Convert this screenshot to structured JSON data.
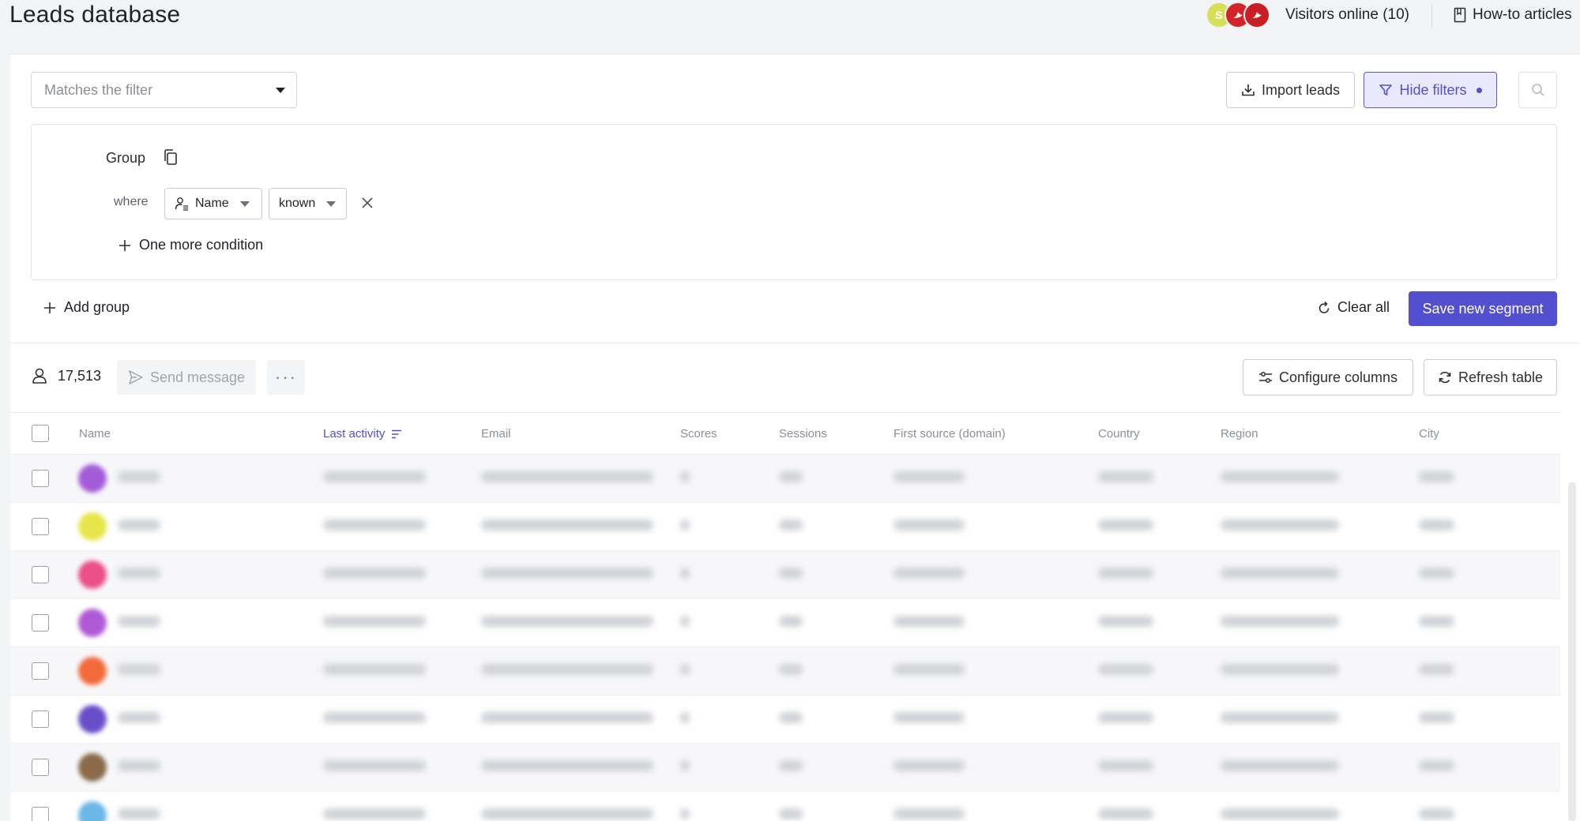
{
  "header": {
    "title": "Leads database",
    "avatar_initial": "S",
    "visitors_label": "Visitors online (10)",
    "howto_label": "How-to articles"
  },
  "filters": {
    "segment_placeholder": "Matches the filter",
    "import_label": "Import leads",
    "hide_filters_label": "Hide filters",
    "group_label": "Group",
    "where_label": "where",
    "property_value": "Name",
    "operator_value": "known",
    "add_condition_label": "One more condition",
    "add_group_label": "Add group",
    "clear_all_label": "Clear all",
    "save_segment_label": "Save new segment"
  },
  "toolbar": {
    "lead_count": "17,513",
    "send_message_label": "Send message",
    "more_label": "···",
    "configure_columns_label": "Configure columns",
    "refresh_label": "Refresh table"
  },
  "table": {
    "columns": [
      "Name",
      "Last activity",
      "Email",
      "Scores",
      "Sessions",
      "First source (domain)",
      "Country",
      "Region",
      "City"
    ],
    "rows": [
      {
        "avatar_color": "#a45bd8"
      },
      {
        "avatar_color": "#e6e64a"
      },
      {
        "avatar_color": "#ea4f86"
      },
      {
        "avatar_color": "#b059d6"
      },
      {
        "avatar_color": "#f26a3a"
      },
      {
        "avatar_color": "#6a4ec9"
      },
      {
        "avatar_color": "#8a6a4a"
      },
      {
        "avatar_color": "#6ab8e8"
      }
    ]
  },
  "colors": {
    "accent": "#5250d0",
    "accent_light": "#e9e9fb"
  }
}
